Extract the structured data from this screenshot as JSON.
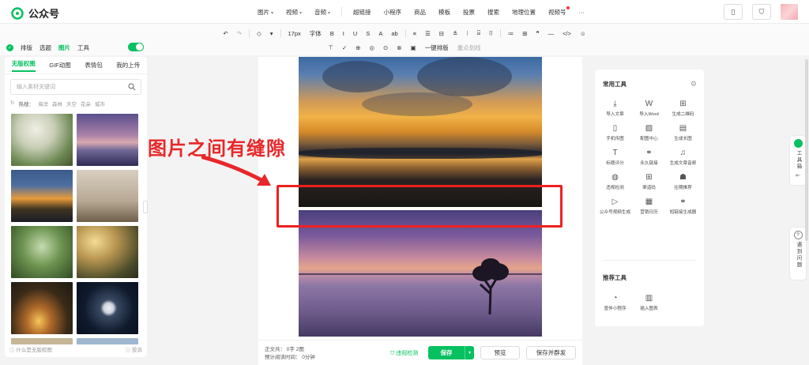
{
  "app": {
    "title": "公众号"
  },
  "topnav": {
    "items": [
      "图片",
      "视频",
      "音频",
      "超链接",
      "小程序",
      "商品",
      "模板",
      "投票",
      "搜索",
      "地理位置",
      "视频号",
      "···"
    ],
    "caret_items": [
      0
    ]
  },
  "toolbar": {
    "row1": [
      "↶",
      "↷",
      "◇",
      "▾",
      "17px",
      "字体",
      "B",
      "I",
      "U",
      "S",
      "A",
      "ab",
      "≡",
      "☰",
      "⊟",
      "≚",
      "⁝",
      "⌸",
      "⌷",
      "≔",
      "⊞",
      "❞",
      "—",
      "</>",
      "☺"
    ],
    "row2": [
      "⊤",
      "✓",
      "⊕",
      "◎",
      "⊙",
      "⊗",
      "▣",
      "一键排版",
      "重点划线"
    ]
  },
  "left": {
    "top_tabs": [
      "排版",
      "选题",
      "图片",
      "工具"
    ],
    "active_top_tab": "图片",
    "tabs": [
      "无版权图",
      "GIF动图",
      "表情包",
      "我的上传"
    ],
    "search_placeholder": "输入素材关键词",
    "hot_label": "热搜：",
    "hot_terms": [
      "海洋",
      "森林",
      "天空",
      "花朵",
      "城市"
    ],
    "footer_left": "什么是无版权图",
    "footer_right": "投诉"
  },
  "editor": {
    "callout": "图片之间有缝隙"
  },
  "bottombar": {
    "word_count": "正文共：   0字 2图",
    "read_time": "预计阅读时间：   0分钟",
    "check": "违规检测",
    "save": "保存",
    "preview": "预览",
    "save_send": "保存并群发"
  },
  "right": {
    "common_title": "常用工具",
    "common_tools": [
      {
        "label": "导入文章",
        "icon": "⤓"
      },
      {
        "label": "导入Word",
        "icon": "W"
      },
      {
        "label": "生成二维码",
        "icon": "⊞"
      },
      {
        "label": "手机传图",
        "icon": "▯"
      },
      {
        "label": "配图中心",
        "icon": "▨"
      },
      {
        "label": "生成长图",
        "icon": "▤"
      },
      {
        "label": "标题评分",
        "icon": "T"
      },
      {
        "label": "永久链接",
        "icon": "⚭"
      },
      {
        "label": "生成文章音频",
        "icon": "♫"
      },
      {
        "label": "违规检测",
        "icon": "◍"
      },
      {
        "label": "渠道码",
        "icon": "⊞"
      },
      {
        "label": "往期推荐",
        "icon": "☗"
      },
      {
        "label": "公众号视频生成",
        "icon": "▷"
      },
      {
        "label": "营销日历",
        "icon": "▦"
      },
      {
        "label": "短链接生成器",
        "icon": "⚭"
      }
    ],
    "rec_title": "推荐工具",
    "rec_tools": [
      {
        "label": "壹伴小程序",
        "icon": "◔"
      },
      {
        "label": "插入图表",
        "icon": "▥"
      }
    ]
  },
  "side": {
    "toolbox": "工具箱",
    "help": "遇到问题"
  }
}
